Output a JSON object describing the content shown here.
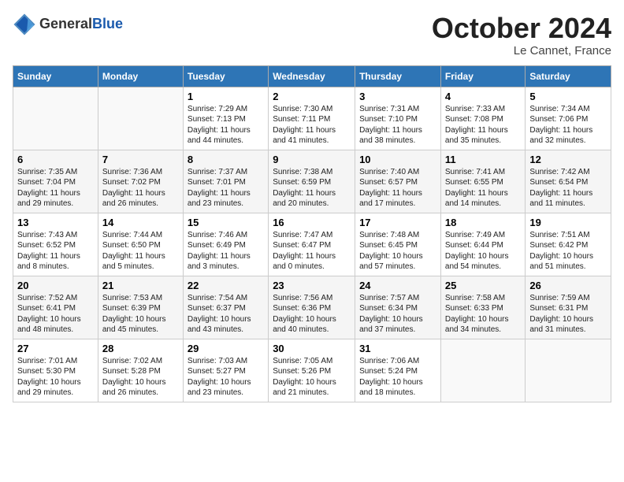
{
  "header": {
    "logo_general": "General",
    "logo_blue": "Blue",
    "month": "October 2024",
    "location": "Le Cannet, France"
  },
  "weekdays": [
    "Sunday",
    "Monday",
    "Tuesday",
    "Wednesday",
    "Thursday",
    "Friday",
    "Saturday"
  ],
  "weeks": [
    [
      {
        "day": "",
        "info": ""
      },
      {
        "day": "",
        "info": ""
      },
      {
        "day": "1",
        "info": "Sunrise: 7:29 AM\nSunset: 7:13 PM\nDaylight: 11 hours and 44 minutes."
      },
      {
        "day": "2",
        "info": "Sunrise: 7:30 AM\nSunset: 7:11 PM\nDaylight: 11 hours and 41 minutes."
      },
      {
        "day": "3",
        "info": "Sunrise: 7:31 AM\nSunset: 7:10 PM\nDaylight: 11 hours and 38 minutes."
      },
      {
        "day": "4",
        "info": "Sunrise: 7:33 AM\nSunset: 7:08 PM\nDaylight: 11 hours and 35 minutes."
      },
      {
        "day": "5",
        "info": "Sunrise: 7:34 AM\nSunset: 7:06 PM\nDaylight: 11 hours and 32 minutes."
      }
    ],
    [
      {
        "day": "6",
        "info": "Sunrise: 7:35 AM\nSunset: 7:04 PM\nDaylight: 11 hours and 29 minutes."
      },
      {
        "day": "7",
        "info": "Sunrise: 7:36 AM\nSunset: 7:02 PM\nDaylight: 11 hours and 26 minutes."
      },
      {
        "day": "8",
        "info": "Sunrise: 7:37 AM\nSunset: 7:01 PM\nDaylight: 11 hours and 23 minutes."
      },
      {
        "day": "9",
        "info": "Sunrise: 7:38 AM\nSunset: 6:59 PM\nDaylight: 11 hours and 20 minutes."
      },
      {
        "day": "10",
        "info": "Sunrise: 7:40 AM\nSunset: 6:57 PM\nDaylight: 11 hours and 17 minutes."
      },
      {
        "day": "11",
        "info": "Sunrise: 7:41 AM\nSunset: 6:55 PM\nDaylight: 11 hours and 14 minutes."
      },
      {
        "day": "12",
        "info": "Sunrise: 7:42 AM\nSunset: 6:54 PM\nDaylight: 11 hours and 11 minutes."
      }
    ],
    [
      {
        "day": "13",
        "info": "Sunrise: 7:43 AM\nSunset: 6:52 PM\nDaylight: 11 hours and 8 minutes."
      },
      {
        "day": "14",
        "info": "Sunrise: 7:44 AM\nSunset: 6:50 PM\nDaylight: 11 hours and 5 minutes."
      },
      {
        "day": "15",
        "info": "Sunrise: 7:46 AM\nSunset: 6:49 PM\nDaylight: 11 hours and 3 minutes."
      },
      {
        "day": "16",
        "info": "Sunrise: 7:47 AM\nSunset: 6:47 PM\nDaylight: 11 hours and 0 minutes."
      },
      {
        "day": "17",
        "info": "Sunrise: 7:48 AM\nSunset: 6:45 PM\nDaylight: 10 hours and 57 minutes."
      },
      {
        "day": "18",
        "info": "Sunrise: 7:49 AM\nSunset: 6:44 PM\nDaylight: 10 hours and 54 minutes."
      },
      {
        "day": "19",
        "info": "Sunrise: 7:51 AM\nSunset: 6:42 PM\nDaylight: 10 hours and 51 minutes."
      }
    ],
    [
      {
        "day": "20",
        "info": "Sunrise: 7:52 AM\nSunset: 6:41 PM\nDaylight: 10 hours and 48 minutes."
      },
      {
        "day": "21",
        "info": "Sunrise: 7:53 AM\nSunset: 6:39 PM\nDaylight: 10 hours and 45 minutes."
      },
      {
        "day": "22",
        "info": "Sunrise: 7:54 AM\nSunset: 6:37 PM\nDaylight: 10 hours and 43 minutes."
      },
      {
        "day": "23",
        "info": "Sunrise: 7:56 AM\nSunset: 6:36 PM\nDaylight: 10 hours and 40 minutes."
      },
      {
        "day": "24",
        "info": "Sunrise: 7:57 AM\nSunset: 6:34 PM\nDaylight: 10 hours and 37 minutes."
      },
      {
        "day": "25",
        "info": "Sunrise: 7:58 AM\nSunset: 6:33 PM\nDaylight: 10 hours and 34 minutes."
      },
      {
        "day": "26",
        "info": "Sunrise: 7:59 AM\nSunset: 6:31 PM\nDaylight: 10 hours and 31 minutes."
      }
    ],
    [
      {
        "day": "27",
        "info": "Sunrise: 7:01 AM\nSunset: 5:30 PM\nDaylight: 10 hours and 29 minutes."
      },
      {
        "day": "28",
        "info": "Sunrise: 7:02 AM\nSunset: 5:28 PM\nDaylight: 10 hours and 26 minutes."
      },
      {
        "day": "29",
        "info": "Sunrise: 7:03 AM\nSunset: 5:27 PM\nDaylight: 10 hours and 23 minutes."
      },
      {
        "day": "30",
        "info": "Sunrise: 7:05 AM\nSunset: 5:26 PM\nDaylight: 10 hours and 21 minutes."
      },
      {
        "day": "31",
        "info": "Sunrise: 7:06 AM\nSunset: 5:24 PM\nDaylight: 10 hours and 18 minutes."
      },
      {
        "day": "",
        "info": ""
      },
      {
        "day": "",
        "info": ""
      }
    ]
  ]
}
